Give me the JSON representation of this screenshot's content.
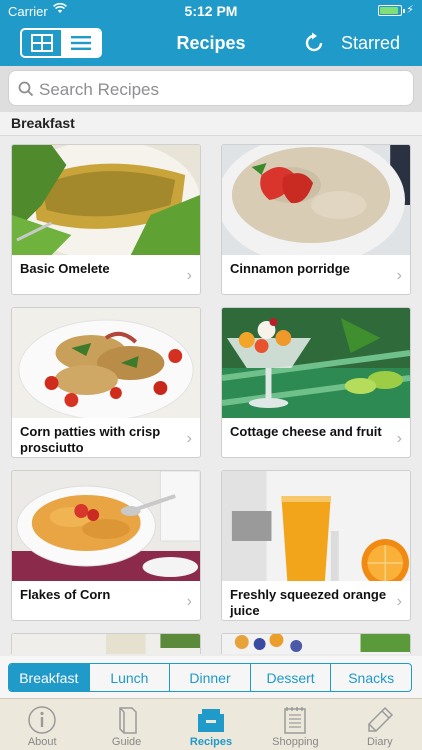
{
  "status": {
    "carrier": "Carrier",
    "time": "5:12 PM"
  },
  "nav": {
    "title": "Recipes",
    "right_label": "Starred"
  },
  "search": {
    "placeholder": "Search Recipes"
  },
  "section_title": "Breakfast",
  "recipes": [
    {
      "name": "Basic Omelete"
    },
    {
      "name": "Cinnamon porridge"
    },
    {
      "name": "Corn patties with crisp prosciutto"
    },
    {
      "name": "Cottage cheese and fruit"
    },
    {
      "name": "Flakes of Corn"
    },
    {
      "name": "Freshly squeezed orange juice"
    }
  ],
  "categories": [
    "Breakfast",
    "Lunch",
    "Dinner",
    "Dessert",
    "Snacks"
  ],
  "active_category": "Breakfast",
  "tabs": [
    "About",
    "Guide",
    "Recipes",
    "Shopping",
    "Diary"
  ],
  "active_tab": "Recipes",
  "colors": {
    "accent": "#1f9ac9",
    "battery": "#7fe07a"
  }
}
